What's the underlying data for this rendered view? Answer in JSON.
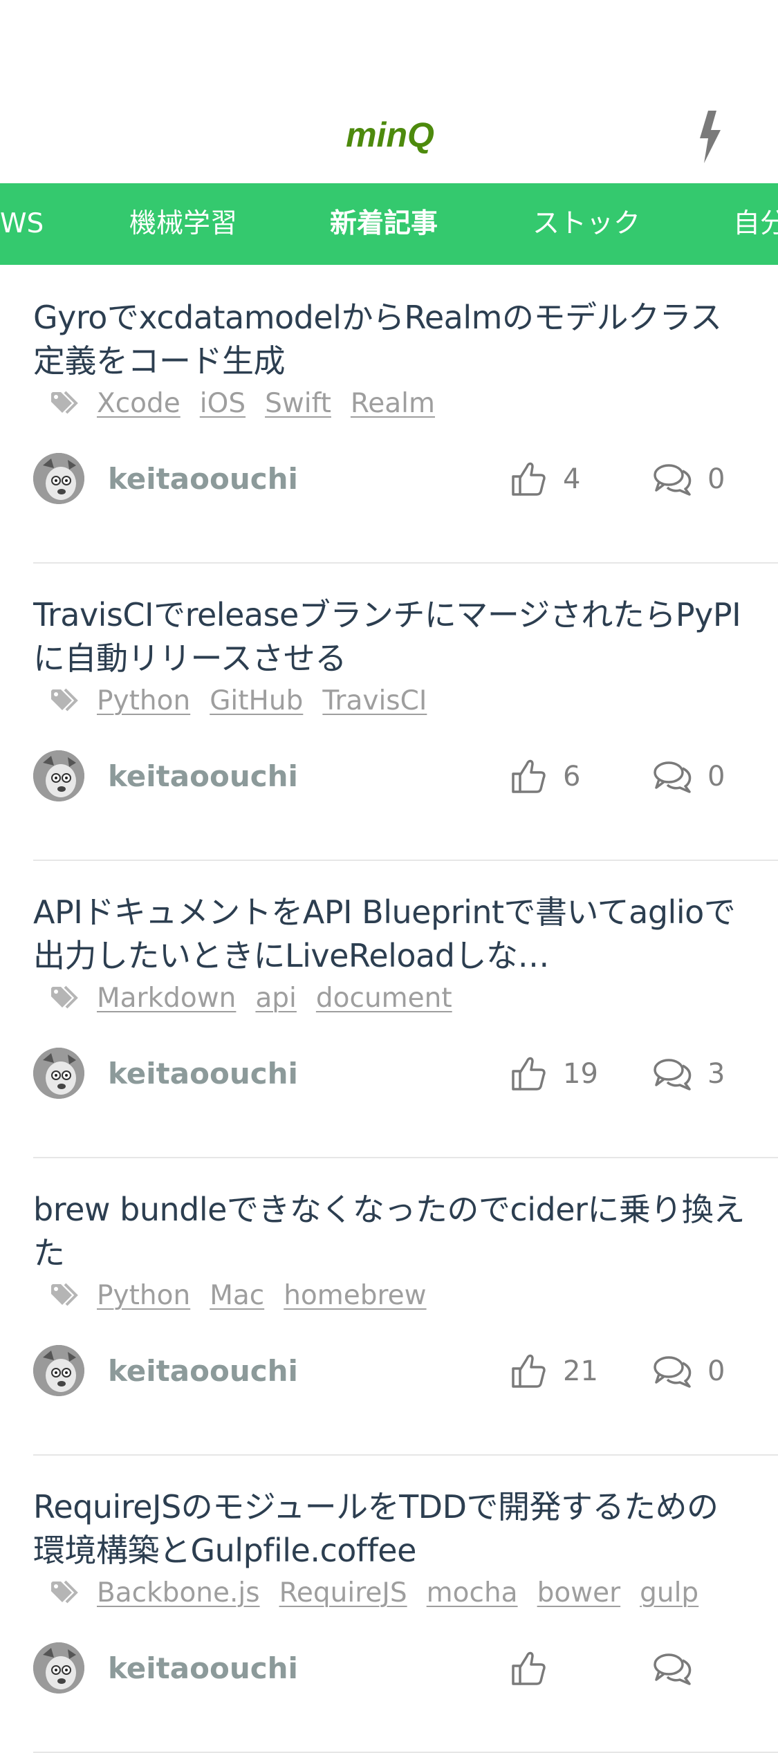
{
  "header": {
    "logo_text": "minQ",
    "logo_color": "#4d8a0d",
    "action_icon": "lightning-bolt-icon"
  },
  "tabs": [
    {
      "label": "WS",
      "active": false
    },
    {
      "label": "機械学習",
      "active": false
    },
    {
      "label": "新着記事",
      "active": true
    },
    {
      "label": "ストック",
      "active": false
    },
    {
      "label": "自分",
      "active": false
    }
  ],
  "accent_color": "#34c96e",
  "articles": [
    {
      "title": "GyroでxcdatamodelからRealmのモデルクラス定義をコード生成",
      "tags": [
        "Xcode",
        "iOS",
        "Swift",
        "Realm"
      ],
      "author": "keitaoouchi",
      "likes": "4",
      "comments": "0"
    },
    {
      "title": "TravisCIでreleaseブランチにマージされたらPyPIに自動リリースさせる",
      "tags": [
        "Python",
        "GitHub",
        "TravisCI"
      ],
      "author": "keitaoouchi",
      "likes": "6",
      "comments": "0"
    },
    {
      "title": "APIドキュメントをAPI Blueprintで書いてaglioで出力したいときにLiveReloadしな…",
      "tags": [
        "Markdown",
        "api",
        "document"
      ],
      "author": "keitaoouchi",
      "likes": "19",
      "comments": "3"
    },
    {
      "title": "brew bundleできなくなったのでciderに乗り換えた",
      "tags": [
        "Python",
        "Mac",
        "homebrew"
      ],
      "author": "keitaoouchi",
      "likes": "21",
      "comments": "0"
    },
    {
      "title": "RequireJSのモジュールをTDDで開発するための環境構築とGulpfile.coffee",
      "tags": [
        "Backbone.js",
        "RequireJS",
        "mocha",
        "bower",
        "gulp"
      ],
      "author": "keitaoouchi",
      "likes": "",
      "comments": ""
    }
  ]
}
